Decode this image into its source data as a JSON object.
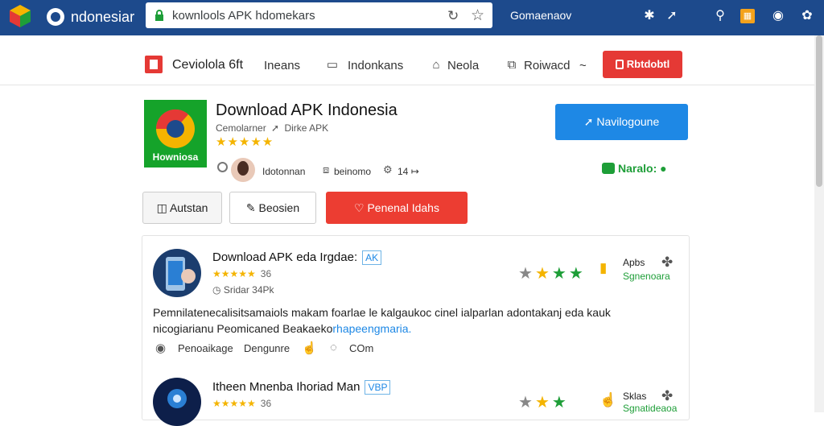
{
  "browser": {
    "title": "ndonesiar",
    "url": "kownlools APK hdomekars",
    "profile": "Gomaenaov",
    "icons": [
      "apps-icon",
      "pin-icon",
      "search-icon",
      "calendar-icon",
      "help-icon",
      "settings-icon"
    ]
  },
  "nav": {
    "site_name": "Ceviolola 6ft",
    "items": [
      "Ineans",
      "Indonkans",
      "Neola",
      "Roiwacd"
    ],
    "chevron": "~",
    "cta": "Rbtdobtl"
  },
  "app": {
    "icon_label": "Howniosa",
    "title": "Download APK Indonesia",
    "developer": "Cemolarner",
    "developer_tag": "Dirke APK",
    "rating": "★★★★★",
    "meta": [
      "Idotonnan",
      "beinomo",
      "14"
    ],
    "install_label": "Navilogoune",
    "badge": "Naralo:"
  },
  "actions": [
    "Autstan",
    "Beosien",
    "Penenal Idahs"
  ],
  "reviews": [
    {
      "title": "Download APK eda Irgdae:",
      "tag": "AK",
      "stars": "★★★★★",
      "count": "36",
      "sub": "Sridar 34Pk",
      "side_label": "Apbs",
      "side_green": "Sgnenoara",
      "body": "Pemnilatenecalisitsamaiols makam foarlae le kalgaukoc cinel ialparlan adontakanj eda kauk nicogiarianu Peomicaned Beakaeko",
      "body_link": "rhapeengmaria.",
      "footer": [
        "Penoaikage",
        "Dengunre",
        "COm"
      ]
    },
    {
      "title": "Itheen Mnenba Ihoriad Man",
      "tag": "VBP",
      "stars": "★★★★★",
      "count": "36",
      "side_label": "Sklas",
      "side_green": "Sgnatideaoa"
    }
  ],
  "colors": {
    "topbar": "#1d4a8c",
    "accent_red": "#e53935",
    "accent_blue": "#1e88e5",
    "accent_green": "#1e9e38",
    "star_yellow": "#f4b400"
  }
}
